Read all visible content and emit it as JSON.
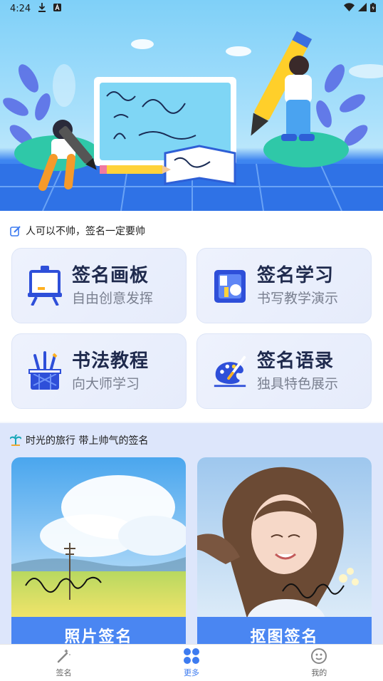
{
  "status_bar": {
    "time": "4:24"
  },
  "section1": {
    "title": "人可以不帅，签名一定要帅",
    "cards": [
      {
        "title": "签名画板",
        "subtitle": "自由创意发挥",
        "icon": "easel-icon"
      },
      {
        "title": "签名学习",
        "subtitle": "书写教学演示",
        "icon": "notebook-icon"
      },
      {
        "title": "书法教程",
        "subtitle": "向大师学习",
        "icon": "pen-holder-icon"
      },
      {
        "title": "签名语录",
        "subtitle": "独具特色展示",
        "icon": "palette-icon"
      }
    ]
  },
  "section2": {
    "title": "时光的旅行 带上帅气的签名",
    "photos": [
      {
        "label": "照片签名"
      },
      {
        "label": "抠图签名"
      }
    ]
  },
  "bottom_nav": {
    "items": [
      {
        "label": "签名",
        "active": false
      },
      {
        "label": "更多",
        "active": true
      },
      {
        "label": "我的",
        "active": false
      }
    ]
  },
  "colors": {
    "accent": "#3d7bf0",
    "button_blue": "#4a86f2",
    "card_title": "#1f2a4d"
  }
}
